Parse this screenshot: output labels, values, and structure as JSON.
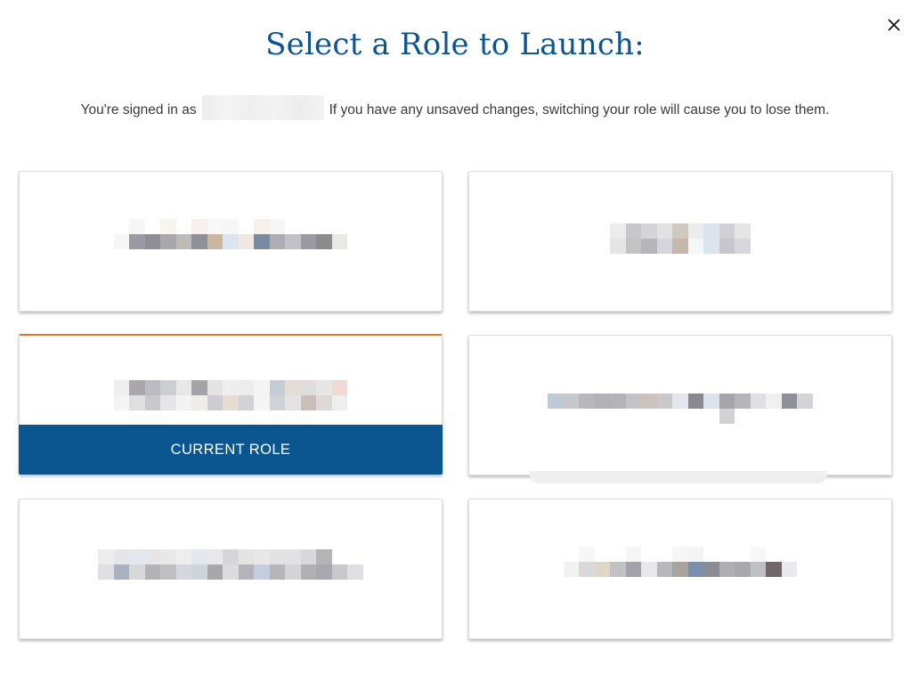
{
  "dialog": {
    "title": "Select a Role to Launch:",
    "signed_in_prefix": "You're signed in as",
    "signed_in_suffix": "If you have any unsaved changes, switching your role will cause you to lose them.",
    "close_icon": "close-icon",
    "close_symbol": "✕"
  },
  "roles": [
    {
      "current": false,
      "label_colors": [
        [
          "#ffffff",
          "#f6f6f6",
          "#ffffff",
          "#f8f4f0",
          "#ffffff",
          "#f7f2ef",
          "#faf8f6",
          "#f6f6f6",
          "#ffffff",
          "#f7f1ee",
          "#f6f6f6",
          "#ffffff",
          "#ffffff",
          "#ffffff"
        ],
        [
          "#f6f6f6",
          "#9a9aa2",
          "#8e8e96",
          "#a9a7ac",
          "#bdbbb8",
          "#8f9098",
          "#cbb79e",
          "#dde5ec",
          "#efe9e5",
          "#7a8aa0",
          "#adadb3",
          "#c2c1c6",
          "#9a99a4",
          "#8b8b8f",
          "#e8e8e4"
        ]
      ]
    },
    {
      "current": false,
      "label_colors": [
        [
          "#ececec",
          "#c8c8cc",
          "#d5d4d6",
          "#e2e2e2",
          "#cfc8bf",
          "#ececef",
          "#dde3ec",
          "#d0d1d6",
          "#e5e5e8"
        ],
        [
          "#e5e5e6",
          "#c3c3c6",
          "#b5b5ba",
          "#d6d6da",
          "#c4b8ad",
          "#f4f6f8",
          "#dde5ec",
          "#c6c7cc",
          "#d8d8dc"
        ]
      ]
    },
    {
      "current": true,
      "current_label": "CURRENT ROLE",
      "label_colors": [
        [
          "#eeeeee",
          "#aaa6ab",
          "#bcbbbf",
          "#cdced3",
          "#e8e8e8",
          "#a4a4a8",
          "#e5e4e4",
          "#eeeeee",
          "#ececec",
          "#f4f4f4",
          "#c6ccd6",
          "#e5dcd6",
          "#e0dedc",
          "#e8e6e5",
          "#efdad4"
        ],
        [
          "#f4f4f4",
          "#dfdfe1",
          "#c9c9cc",
          "#e6e6e8",
          "#f3f3f3",
          "#f0ece8",
          "#cdcdd1",
          "#e5dcd3",
          "#d2d2d4",
          "#f4f4f4",
          "#cfd2d9",
          "#e4e2e2",
          "#c9bfb8",
          "#dedad8",
          "#efeeee"
        ]
      ]
    },
    {
      "current": false,
      "label_colors": [
        [
          "#bfcad7",
          "#c6c8cc",
          "#b8b8bc",
          "#b2b2b6",
          "#b4b4b7",
          "#c4c4c7",
          "#cbc3bc",
          "#c9c9cc",
          "#e3e6ea",
          "#8a8a8e",
          "#dbe3ec",
          "#a6a6aa",
          "#b6b6ba",
          "#e0e0e2",
          "#f0f0f0",
          "#8e9199",
          "#d4d4d7"
        ],
        [
          "#ffffff",
          "#ffffff",
          "#ffffff",
          "#ffffff",
          "#ffffff",
          "#ffffff",
          "#ffffff",
          "#ffffff",
          "#ffffff",
          "#ffffff",
          "#ffffff",
          "#d2d2d5",
          "#ffffff",
          "#ffffff",
          "#ffffff",
          "#ffffff",
          "#ffffff"
        ]
      ]
    },
    {
      "current": false,
      "label_colors": [
        [
          "#ececec",
          "#e4e6e8",
          "#e3e8ee",
          "#e6e6e8",
          "#e8e8e8",
          "#eeeeee",
          "#e2e8ee",
          "#e8e8ea",
          "#d6d6d8",
          "#e4e4e4",
          "#e8e8e8",
          "#e2e2e2",
          "#dfe2e6",
          "#d8d8da",
          "#b4b4b6"
        ],
        [
          "#e0e0e2",
          "#a9b3c0",
          "#d8d8da",
          "#b3b3b6",
          "#c0c0c3",
          "#d4d8dc",
          "#cfd3da",
          "#a8a8ac",
          "#dcdcde",
          "#b4b4b8",
          "#c4cede",
          "#b6b6b8",
          "#d4d4d6",
          "#b0b0b4",
          "#a8a8ae",
          "#c8c8cc",
          "#dedfe2"
        ]
      ]
    },
    {
      "current": false,
      "label_colors": [
        [
          "#ffffff",
          "#f7f7f7",
          "#ffffff",
          "#ffffff",
          "#f5f5f5",
          "#ffffff",
          "#ffffff",
          "#f6f6f6",
          "#f4f4f4",
          "#ffffff",
          "#ffffff",
          "#ffffff",
          "#f7f7f7",
          "#ffffff",
          "#ffffff"
        ],
        [
          "#f2f2f2",
          "#d8d8d8",
          "#e0d6c8",
          "#c2c2c6",
          "#a2a3aa",
          "#e8e8ea",
          "#b8b8bc",
          "#a8a2a0",
          "#7b8eab",
          "#8c8c94",
          "#aeaeb4",
          "#a7a9ad",
          "#c0c0c4",
          "#6f6769",
          "#eaeaec"
        ]
      ]
    }
  ]
}
